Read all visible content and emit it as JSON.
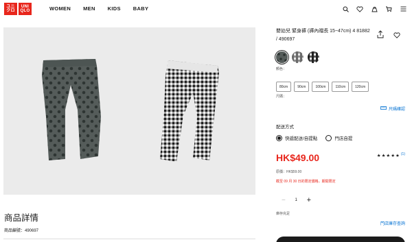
{
  "header": {
    "logo": {
      "line1": "ユニ",
      "line2": "クロ",
      "line3": "UNI",
      "line4": "QLO"
    },
    "nav": [
      "WOMEN",
      "MEN",
      "KIDS",
      "BABY"
    ],
    "icons": [
      "search-icon",
      "heart-icon",
      "user-icon",
      "cart-icon",
      "menu-icon"
    ]
  },
  "product": {
    "title": "嬰幼兒 緊身褲 (褲內襠長 15~47cm) 4 81882 / 490697",
    "color_label": "顏色：",
    "colors": [
      {
        "name": "dark-gray-dots",
        "hex": "#4d5553",
        "selected": true
      },
      {
        "name": "gray-check",
        "hex": "#777777",
        "selected": false
      },
      {
        "name": "black-check",
        "hex": "#333333",
        "selected": false
      }
    ],
    "sizes": [
      "80cm",
      "90cm",
      "100cm",
      "110cm",
      "120cm"
    ],
    "size_label": "尺碼：",
    "size_guide": "尺碼確認",
    "delivery_title": "配送方式",
    "delivery_options": [
      {
        "label": "快遞配送/自提點",
        "selected": true
      },
      {
        "label": "門店自提",
        "selected": false
      }
    ],
    "price": "HK$49.00",
    "rating": {
      "stars": 5,
      "count": "(1)"
    },
    "original_price": "原價：HK$59.00",
    "limited_notice": "截至 09 月 30 日的限定價格，期間限定",
    "quantity": "1",
    "stock_label": "庫存充足",
    "store_stock": "門店庫存查詢"
  },
  "details": {
    "title": "商品詳情",
    "code": "商品編號：490697"
  },
  "colors": {
    "brand_red": "#e8261c",
    "link_blue": "#0070d2",
    "panel_bg": "#ebebeb"
  }
}
